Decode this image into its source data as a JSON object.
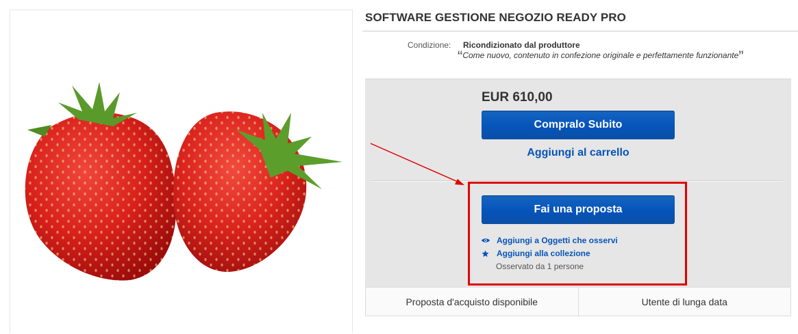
{
  "product": {
    "title": "SOFTWARE GESTIONE NEGOZIO READY PRO"
  },
  "condition": {
    "label": "Condizione:",
    "value": "Ricondizionato dal produttore",
    "description": "Come nuovo, contenuto in confezione originale e perfettamente funzionante",
    "open_quote": "“",
    "close_quote": "”"
  },
  "purchase": {
    "price": "EUR 610,00",
    "buy_now_label": "Compralo Subito",
    "add_to_cart_label": "Aggiungi al carrello",
    "make_offer_label": "Fai una proposta",
    "watch_label": "Aggiungi a Oggetti che osservi",
    "collection_label": "Aggiungi alla collezione",
    "watchers_text": "Osservato da 1 persone"
  },
  "features": [
    "Proposta d'acquisto disponibile",
    "Utente di lunga data"
  ],
  "colors": {
    "accent_blue": "#0654ba",
    "annotation_red": "#e00000",
    "box_gray": "#e6e6e6"
  },
  "icons": {
    "watch": "eye-icon",
    "collection": "star-icon"
  }
}
